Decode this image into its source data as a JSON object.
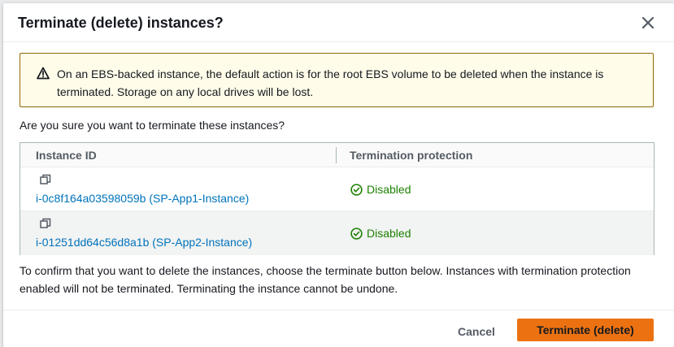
{
  "modal": {
    "title": "Terminate (delete) instances?",
    "close_icon": "close-icon"
  },
  "alert": {
    "icon": "warning-icon",
    "text": "On an EBS-backed instance, the default action is for the root EBS volume to be deleted when the instance is terminated. Storage on any local drives will be lost.",
    "background": "#fffce9",
    "border": "#906806"
  },
  "question": "Are you sure you want to terminate these instances?",
  "table": {
    "columns": [
      "Instance ID",
      "Termination protection"
    ],
    "rows": [
      {
        "instance": "i-0c8f164a03598059b (SP-App1-Instance)",
        "protection": "Disabled"
      },
      {
        "instance": "i-01251dd64c56d8a1b (SP-App2-Instance)",
        "protection": "Disabled"
      }
    ]
  },
  "confirm_text": "To confirm that you want to delete the instances, choose the terminate button below. Instances with termination protection enabled will not be terminated. Terminating the instance cannot be undone.",
  "footer": {
    "cancel_label": "Cancel",
    "terminate_label": "Terminate (delete)"
  },
  "colors": {
    "accent": "#ec7211",
    "link": "#0073bb",
    "success": "#1d8102"
  }
}
